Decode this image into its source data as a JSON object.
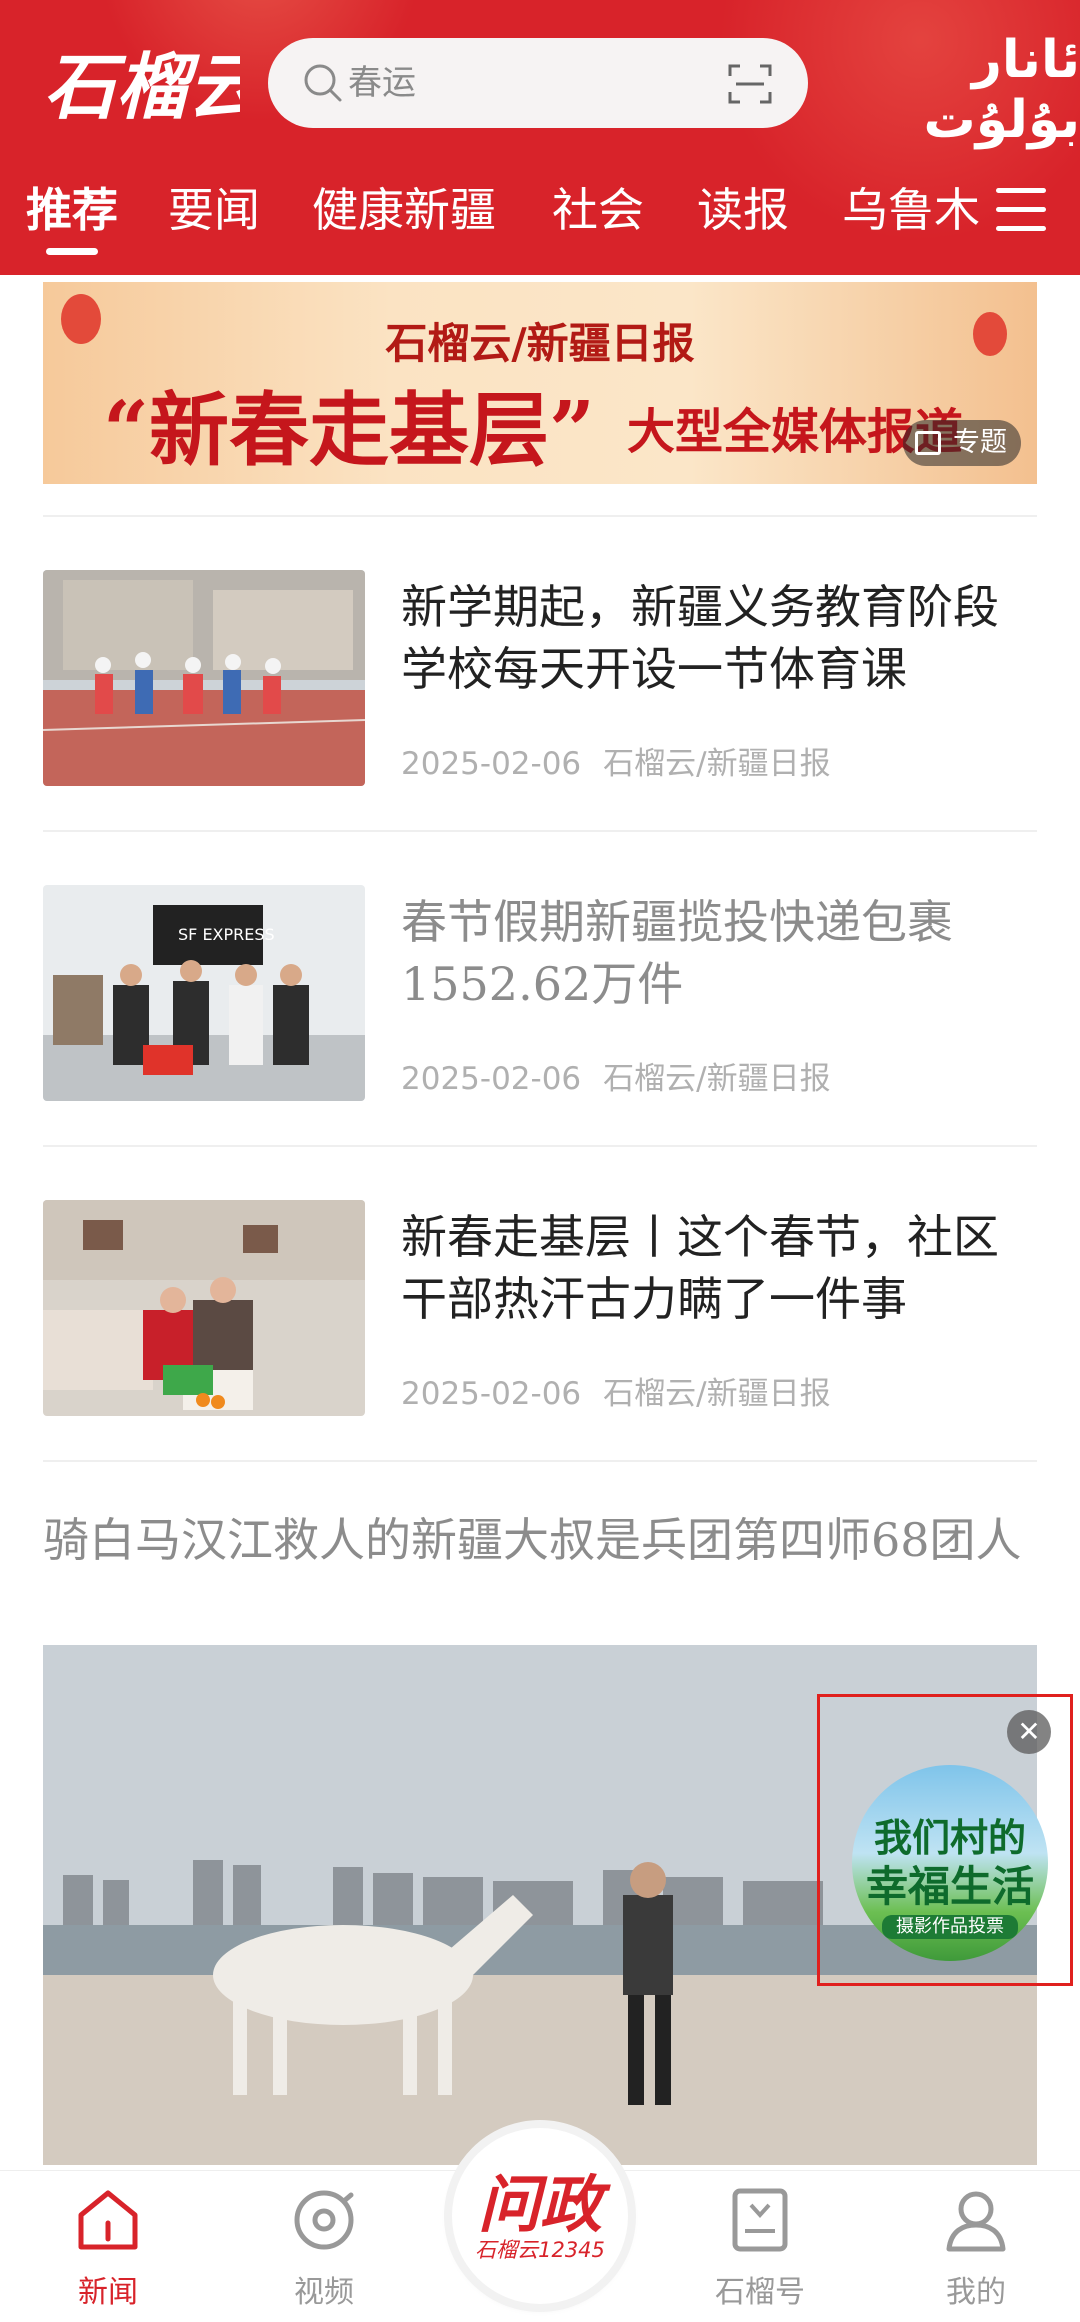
{
  "header": {
    "logo_text": "石榴云",
    "search_placeholder": "春运",
    "language_link": "ئانار بۇلۇت",
    "tabs": [
      {
        "label": "推荐"
      },
      {
        "label": "要闻"
      },
      {
        "label": "健康新疆"
      },
      {
        "label": "社会"
      },
      {
        "label": "读报"
      },
      {
        "label": "乌鲁木"
      }
    ],
    "active_tab": "推荐"
  },
  "banner": {
    "line1": "石榴云/新疆日报",
    "line2": "“新春走基层”",
    "line3": "大型全媒体报道",
    "badge": "专题"
  },
  "news": [
    {
      "title": "新学期起，新疆义务教育阶段学校每天开设一节体育课",
      "date": "2025-02-06",
      "source": "石榴云/新疆日报",
      "read": false
    },
    {
      "title": "春节假期新疆揽投快递包裹1552.62万件",
      "date": "2025-02-06",
      "source": "石榴云/新疆日报",
      "read": true
    },
    {
      "title": "新春走基层丨这个春节，社区干部热汗古力瞒了一件事",
      "date": "2025-02-06",
      "source": "石榴云/新疆日报",
      "read": false
    }
  ],
  "feature": {
    "title": "骑白马汉江救人的新疆大叔是兵团第四师68团人"
  },
  "float_ad": {
    "line1": "我们村的",
    "line2": "幸福生活",
    "line3": "摄影作品投票",
    "close": "✕"
  },
  "bottom_nav": {
    "items": [
      {
        "label": "新闻"
      },
      {
        "label": "视频"
      },
      {
        "label": "石榴号"
      },
      {
        "label": "我的"
      }
    ],
    "center_line1": "问政",
    "center_line2": "石榴云12345",
    "active": "新闻"
  },
  "colors": {
    "brand_red": "#d8232a",
    "read_gray": "#8c8c8c",
    "meta_gray": "#b0b0b0"
  }
}
